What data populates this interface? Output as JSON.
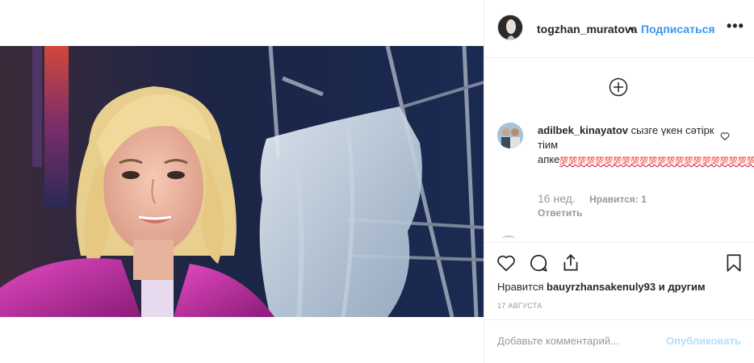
{
  "post": {
    "username": "togzhan_muratova",
    "separator": "•",
    "follow_label": "Подписаться",
    "more_label": "•••"
  },
  "comments": [
    {
      "username": "adilbek_kinayatov",
      "text": "сызге үкен сәтірк тіим апке",
      "emoji_run": "💯💯💯💯💯💯💯💯💯💯💯💯💯💯💯💯💯💯💯💯💯💯💯",
      "age": "16 нед.",
      "likes": "Нравится: 1",
      "reply_label": "Ответить"
    }
  ],
  "likes_line": {
    "prefix": "Нравится",
    "user": "bauyrzhansakenuly93",
    "suffix": "и другим"
  },
  "date": "17 августа",
  "comment_box": {
    "placeholder": "Добавьте комментарий...",
    "publish_label": "Опубликовать"
  },
  "colors": {
    "accent": "#3897f0",
    "publish_disabled": "#b2dffc",
    "muted": "#999999"
  },
  "icons": [
    "add-circle-icon",
    "heart-icon",
    "comment-icon",
    "share-icon",
    "bookmark-icon",
    "more-icon"
  ]
}
